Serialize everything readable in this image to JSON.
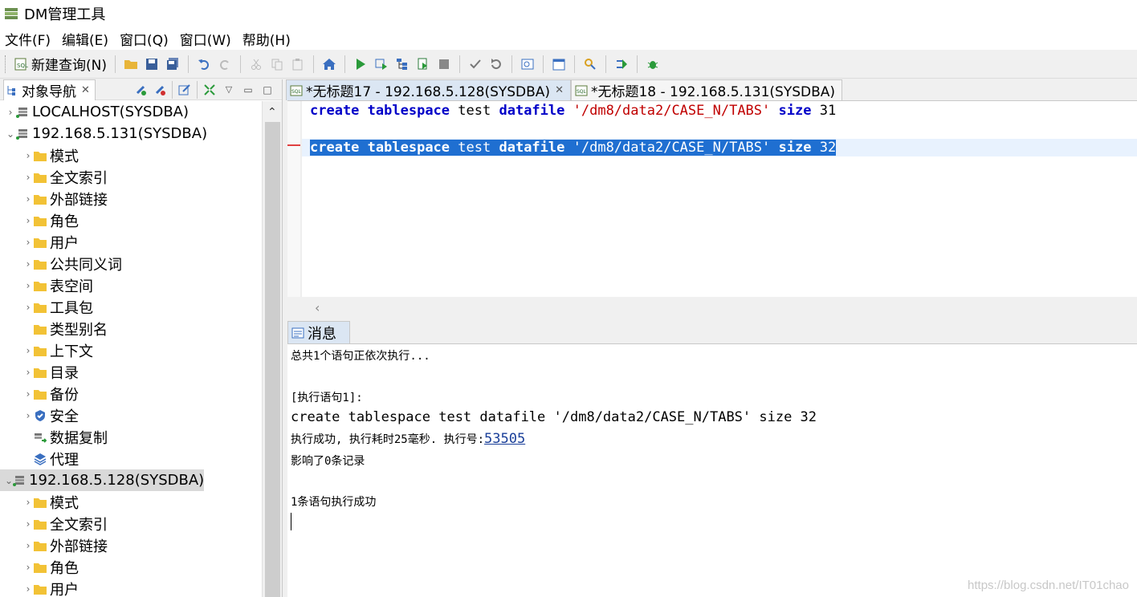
{
  "window": {
    "title": "DM管理工具"
  },
  "menu": [
    "文件(F)",
    "编辑(E)",
    "窗口(Q)",
    "窗口(W)",
    "帮助(H)"
  ],
  "toolbar": {
    "new_query_label": "新建查询(N)"
  },
  "navigator": {
    "tab_label": "对象导航",
    "rows": [
      {
        "label": "LOCALHOST(SYSDBA)",
        "caret": "›",
        "icon": "server-icon"
      },
      {
        "label": "192.168.5.131(SYSDBA)",
        "caret": "⌄",
        "icon": "server-icon"
      },
      {
        "label": "模式",
        "caret": "›",
        "icon": "folder-icon"
      },
      {
        "label": "全文索引",
        "caret": "›",
        "icon": "folder-icon"
      },
      {
        "label": "外部链接",
        "caret": "›",
        "icon": "folder-icon"
      },
      {
        "label": "角色",
        "caret": "›",
        "icon": "folder-icon"
      },
      {
        "label": "用户",
        "caret": "›",
        "icon": "folder-icon"
      },
      {
        "label": "公共同义词",
        "caret": "›",
        "icon": "folder-icon"
      },
      {
        "label": "表空间",
        "caret": "›",
        "icon": "folder-icon"
      },
      {
        "label": "工具包",
        "caret": "›",
        "icon": "folder-icon"
      },
      {
        "label": "类型别名",
        "caret": "",
        "icon": "folder-icon"
      },
      {
        "label": "上下文",
        "caret": "›",
        "icon": "folder-icon"
      },
      {
        "label": "目录",
        "caret": "›",
        "icon": "folder-icon"
      },
      {
        "label": "备份",
        "caret": "›",
        "icon": "folder-icon"
      },
      {
        "label": "安全",
        "caret": "›",
        "icon": "shield-icon"
      },
      {
        "label": "数据复制",
        "caret": "",
        "icon": "replication-icon"
      },
      {
        "label": "代理",
        "caret": "",
        "icon": "agent-icon"
      },
      {
        "label": "192.168.5.128(SYSDBA)",
        "caret": "⌄",
        "icon": "server-icon"
      },
      {
        "label": "模式",
        "caret": "›",
        "icon": "folder-icon"
      },
      {
        "label": "全文索引",
        "caret": "›",
        "icon": "folder-icon"
      },
      {
        "label": "外部链接",
        "caret": "›",
        "icon": "folder-icon"
      },
      {
        "label": "角色",
        "caret": "›",
        "icon": "folder-icon"
      },
      {
        "label": "用户",
        "caret": "›",
        "icon": "folder-icon"
      }
    ]
  },
  "editor": {
    "tabs": [
      {
        "label": "*无标题17 - 192.168.5.128(SYSDBA)",
        "active": true
      },
      {
        "label": "*无标题18 - 192.168.5.131(SYSDBA)",
        "active": false
      }
    ],
    "line1": {
      "kw1": "create",
      "kw2": "tablespace",
      "name": "test",
      "kw3": "datafile",
      "path": "'/dm8/data2/CASE_N/TABS'",
      "kw4": "size",
      "size": "31"
    },
    "line2": {
      "kw1": "create",
      "kw2": "tablespace",
      "name": "test",
      "kw3": "datafile",
      "path": "'/dm8/data2/CASE_N/TABS'",
      "kw4": "size",
      "size": "32"
    }
  },
  "messages": {
    "tab_label": "消息",
    "total": "总共1个语句正依次执行...",
    "stmt_header": "[执行语句1]:",
    "stmt": "create tablespace test datafile '/dm8/data2/CASE_N/TABS' size 32",
    "success_prefix": "执行成功, 执行耗时25毫秒. 执行号:",
    "exec_no": "53505",
    "affected": "影响了0条记录",
    "summary": "1条语句执行成功"
  },
  "watermark": "https://blog.csdn.net/IT01chao",
  "colors": {
    "selection": "#1f6fd1",
    "keyword": "#0000c8",
    "string": "#c00000",
    "active_tab": "#dbe6f3"
  }
}
